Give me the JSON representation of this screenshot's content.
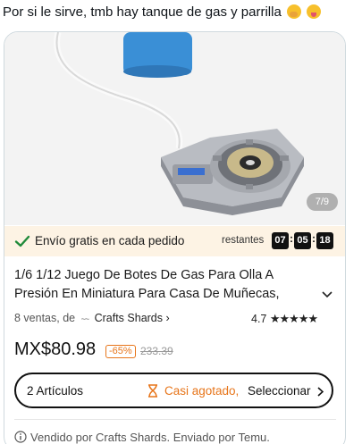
{
  "post": {
    "text": "Por si le sirve, tmb hay tanque de gas y parrilla",
    "emojis": [
      "hand-over-mouth-emoji",
      "winking-tongue-emoji"
    ]
  },
  "product": {
    "image_counter": "7/9",
    "shipping": {
      "text": "Envío gratis en cada pedido",
      "countdown_label": "restantes",
      "hours": "07",
      "minutes": "05",
      "seconds": "18"
    },
    "title_line1": "1/6 1/12 Juego De Botes De Gas Para Olla A",
    "title_line2": "Presión En Miniatura Para Casa De Muñecas,",
    "sales": "8 ventas, de",
    "store_logo": "~~",
    "store": "Crafts Shards",
    "rating": "4.7",
    "stars": "★★★★★",
    "price": "MX$80.98",
    "discount": "-65%",
    "original_price": "233.39",
    "selector": {
      "count": "2 Artículos",
      "scarcity": "Casi agotado,",
      "action": "Seleccionar"
    },
    "footer": "Vendido por Crafts Shards. Enviado por Temu."
  },
  "colors": {
    "accent": "#e7751a",
    "check": "#1f8a3a",
    "ship_bg": "#fdf3e4",
    "tank": "#3a8fd6"
  }
}
